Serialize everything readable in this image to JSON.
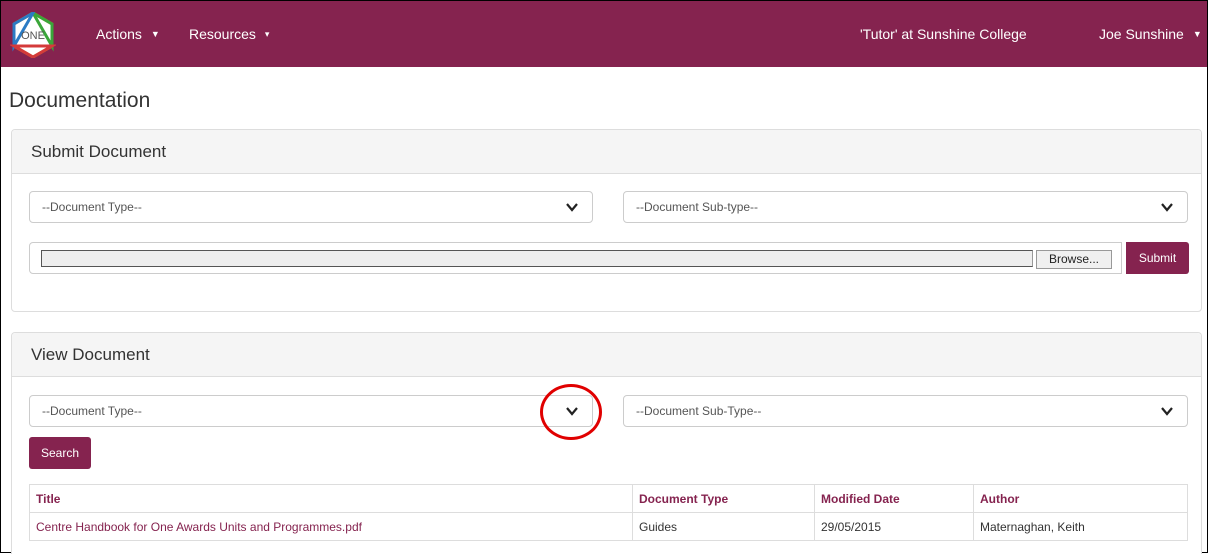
{
  "navbar": {
    "logo_text": "ONE",
    "actions_label": "Actions",
    "resources_label": "Resources",
    "role_label": "'Tutor' at Sunshine College",
    "user_label": "Joe Sunshine"
  },
  "page": {
    "title": "Documentation"
  },
  "submit_panel": {
    "heading": "Submit Document",
    "document_type_placeholder": "--Document Type--",
    "document_subtype_placeholder": "--Document Sub-type--",
    "browse_label": "Browse...",
    "submit_label": "Submit"
  },
  "view_panel": {
    "heading": "View Document",
    "document_type_placeholder": "--Document Type--",
    "document_subtype_placeholder": "--Document Sub-Type--",
    "search_label": "Search",
    "table": {
      "headers": [
        "Title",
        "Document Type",
        "Modified Date",
        "Author"
      ],
      "rows": [
        [
          "Centre Handbook for One Awards Units and Programmes.pdf",
          "Guides",
          "29/05/2015",
          "Maternaghan, Keith"
        ]
      ]
    }
  },
  "colors": {
    "brand": "#85234f",
    "highlight": "#e00000"
  }
}
